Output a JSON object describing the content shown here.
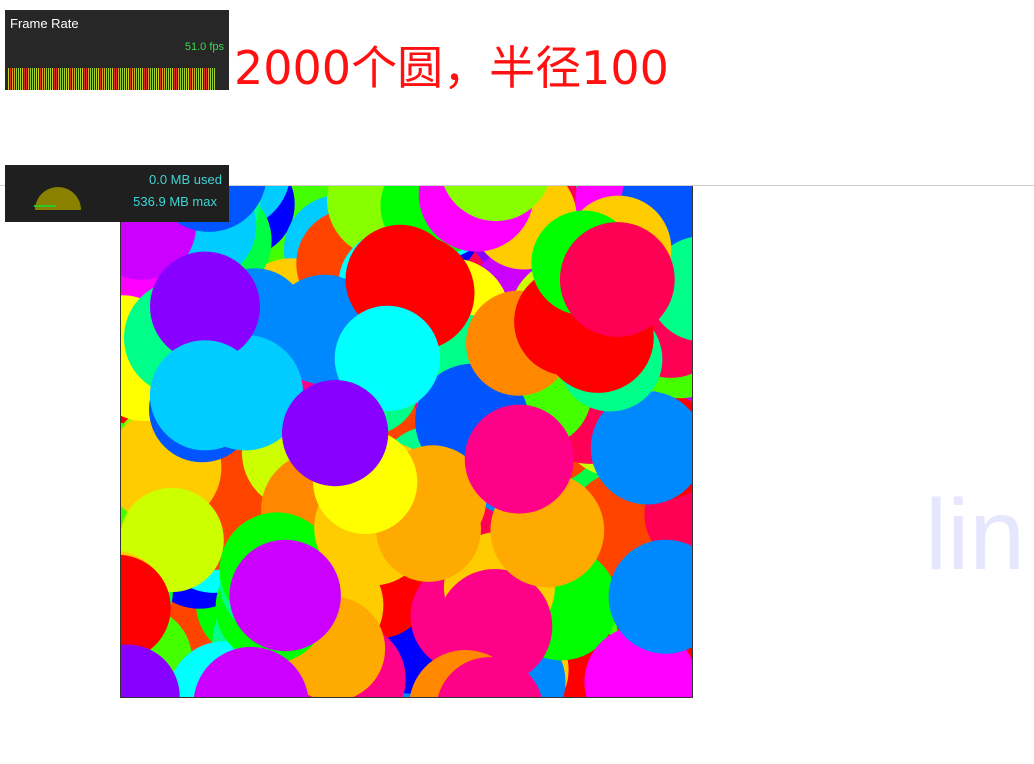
{
  "fps_panel": {
    "title": "Frame Rate",
    "value": "51.0 fps",
    "bar_colors": [
      "#c6d61a",
      "#d9a51e",
      "#a5d233",
      "#e02f2f",
      "#8fd03a"
    ]
  },
  "page_title": "2000个圆，半径100",
  "memory_panel": {
    "used": "0.0 MB used",
    "max": "536.9 MB max",
    "gauge_color": "#8a8100"
  },
  "watermark": "lin",
  "colors": {
    "title": "#ff1111",
    "divider": "#cfcfcf",
    "stage_border": "#333333"
  }
}
